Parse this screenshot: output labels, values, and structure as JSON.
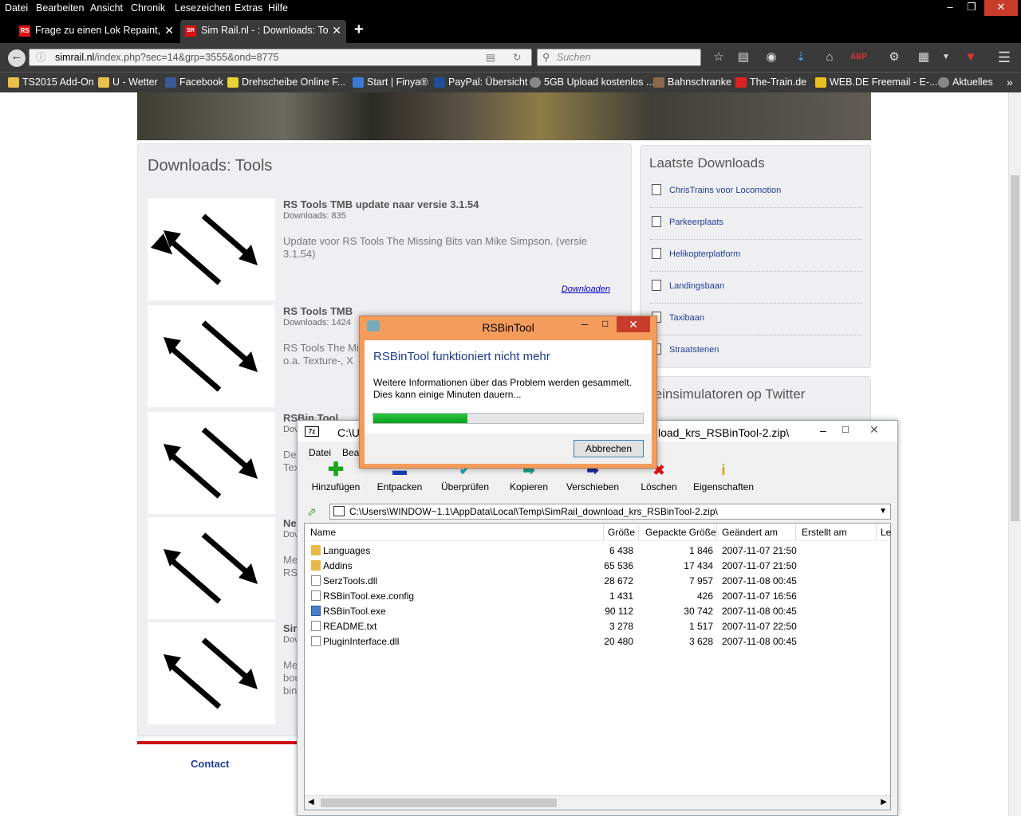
{
  "browser": {
    "menu": [
      "Datei",
      "Bearbeiten",
      "Ansicht",
      "Chronik",
      "Lesezeichen",
      "Extras",
      "Hilfe"
    ],
    "tabs": [
      {
        "label": "Frage zu einen Lok Repaint,",
        "favicon": "RS"
      },
      {
        "label": "Sim Rail.nl - : Downloads: To",
        "favicon": "SR"
      }
    ],
    "new_tab_label": "+",
    "url_host": "simrail.nl",
    "url_path": "/index.php?sec=14&grp=3555&ond=8775",
    "search_placeholder": "Suchen",
    "bookmarks": [
      "TS2015 Add-On",
      "U - Wetter",
      "Facebook",
      "Drehscheibe Online F...",
      "Start | Finya®",
      "PayPal: Übersicht",
      "5GB Upload kostenlos ...",
      "Bahnschranke",
      "The-Train.de",
      "WEB.DE Freemail - E-...",
      "Aktuelles"
    ],
    "overflow": "»"
  },
  "page": {
    "downloads_title": "Downloads: Tools",
    "items": [
      {
        "title": "RS Tools TMB update naar versie 3.1.54",
        "downloads": "Downloads: 835",
        "desc": "Update voor RS Tools The Missing Bits van Mike Simpson. (versie 3.1.54)",
        "link": "Downloaden"
      },
      {
        "title": "RS Tools TMB",
        "downloads": "Downloads: 1424",
        "desc": "RS Tools The Mi\no.a. Texture-, X"
      },
      {
        "title": "RSBin Tool",
        "downloads": "Dov",
        "desc": "De\nTex"
      },
      {
        "title": "Ne",
        "downloads": "Dov",
        "desc": "Me\nRSI"
      },
      {
        "title": "Sir",
        "downloads": "Dov",
        "desc": "Me\nbou\nbin"
      }
    ],
    "latest_title": "Laatste Downloads",
    "latest": [
      "ChrisTrains voor Locomotion",
      "Parkeerplaats",
      "Helikopterplatform",
      "Landingsbaan",
      "Taxibaan",
      "Straatstenen"
    ],
    "twitter_title": "reinsimulatoren op Twitter",
    "contact": "Contact"
  },
  "zip": {
    "title_left": "C:\\U",
    "title_right": "load_krs_RSBinTool-2.zip\\",
    "menu": [
      "Datei",
      "Bea"
    ],
    "toolbar": [
      {
        "label": "Hinzufügen",
        "icon": "plus-icon",
        "color": "#1aa51a"
      },
      {
        "label": "Entpacken",
        "icon": "minus-icon",
        "color": "#1a3fb0"
      },
      {
        "label": "Überprüfen",
        "icon": "check-icon",
        "color": "#22a7b5"
      },
      {
        "label": "Kopieren",
        "icon": "copy-arrow-icon",
        "color": "#1a9a8a"
      },
      {
        "label": "Verschieben",
        "icon": "move-arrow-icon",
        "color": "#1a2a9a"
      },
      {
        "label": "Löschen",
        "icon": "delete-icon",
        "color": "#d11"
      },
      {
        "label": "Eigenschaften",
        "icon": "info-icon",
        "color": "#c9a400"
      }
    ],
    "path": "C:\\Users\\WINDOW~1.1\\AppData\\Local\\Temp\\SimRail_download_krs_RSBinTool-2.zip\\",
    "columns": [
      "Name",
      "Größe",
      "Gepackte Größe",
      "Geändert am",
      "Erstellt am",
      "Le"
    ],
    "rows": [
      {
        "name": "Languages",
        "size": "6 438",
        "packed": "1 846",
        "modified": "2007-11-07 21:50",
        "type": "folder"
      },
      {
        "name": "Addins",
        "size": "65 536",
        "packed": "17 434",
        "modified": "2007-11-07 21:50",
        "type": "folder"
      },
      {
        "name": "SerzTools.dll",
        "size": "28 672",
        "packed": "7 957",
        "modified": "2007-11-08 00:45",
        "type": "file"
      },
      {
        "name": "RSBinTool.exe.config",
        "size": "1 431",
        "packed": "426",
        "modified": "2007-11-07 16:56",
        "type": "file"
      },
      {
        "name": "RSBinTool.exe",
        "size": "90 112",
        "packed": "30 742",
        "modified": "2007-11-08 00:45",
        "type": "exe"
      },
      {
        "name": "README.txt",
        "size": "3 278",
        "packed": "1 517",
        "modified": "2007-11-07 22:50",
        "type": "file"
      },
      {
        "name": "PluginInterface.dll",
        "size": "20 480",
        "packed": "3 628",
        "modified": "2007-11-08 00:45",
        "type": "file"
      }
    ]
  },
  "error": {
    "title": "RSBinTool",
    "heading": "RSBinTool funktioniert nicht mehr",
    "message_line1": "Weitere Informationen über das Problem werden gesammelt.",
    "message_line2": "Dies kann einige Minuten dauern...",
    "progress": 0.35,
    "cancel": "Abbrechen"
  }
}
